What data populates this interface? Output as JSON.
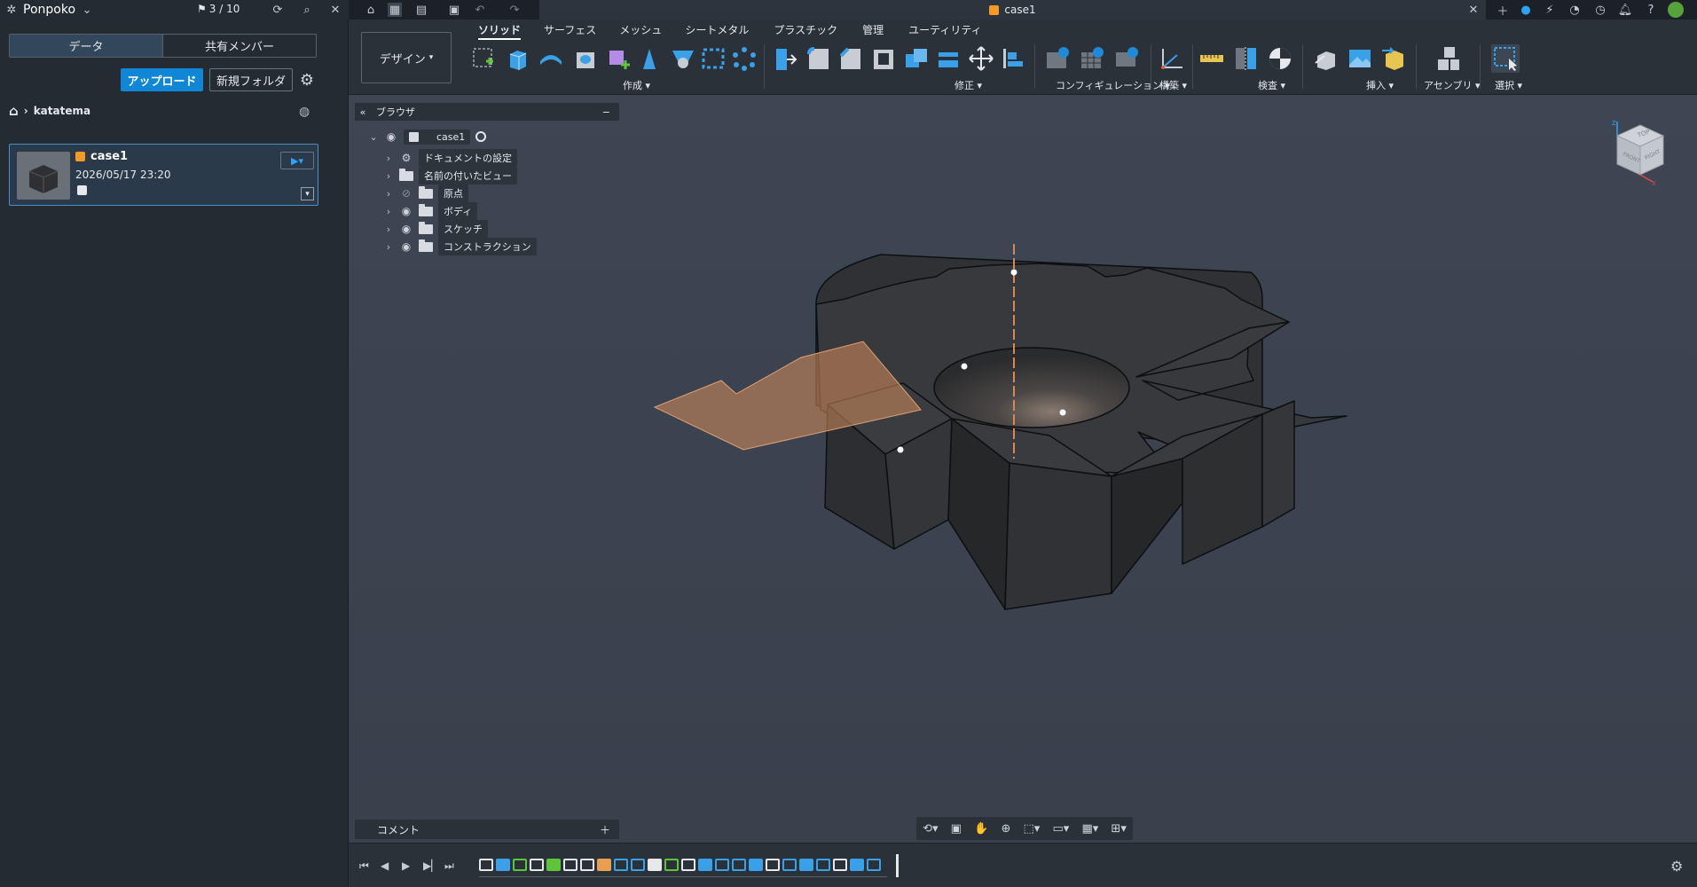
{
  "topbar": {
    "app_name": "Ponpoko",
    "job_count": "3 / 10",
    "doc_tab_title": "case1"
  },
  "datapanel": {
    "tab_data": "データ",
    "tab_members": "共有メンバー",
    "upload_label": "アップロード",
    "new_folder_label": "新規フォルダ",
    "breadcrumb_project": "katatema",
    "file": {
      "name": "case1",
      "date": "2026/05/17 23:20"
    }
  },
  "toolbar": {
    "design_label": "デザイン",
    "tabs": [
      "ソリッド",
      "サーフェス",
      "メッシュ",
      "シートメタル",
      "プラスチック",
      "管理",
      "ユーティリティ"
    ],
    "groups": {
      "create": "作成",
      "modify": "修正",
      "configuration": "コンフィギュレーション",
      "construct": "構築",
      "inspect": "検査",
      "insert": "挿入",
      "assemble": "アセンブリ",
      "select": "選択"
    }
  },
  "browser": {
    "title": "ブラウザ",
    "root": "case1",
    "items": [
      "ドキュメントの設定",
      "名前の付いたビュー",
      "原点",
      "ボディ",
      "スケッチ",
      "コンストラクション"
    ]
  },
  "comment": {
    "label": "コメント"
  },
  "navcube": {
    "top": "TOP",
    "front": "FRONT",
    "right": "RIGHT",
    "z": "Z",
    "x": "X"
  },
  "colors": {
    "accent": "#0f86d6",
    "plane": "#c8875a",
    "body": "#3b3d40",
    "background": "#3c4350"
  }
}
